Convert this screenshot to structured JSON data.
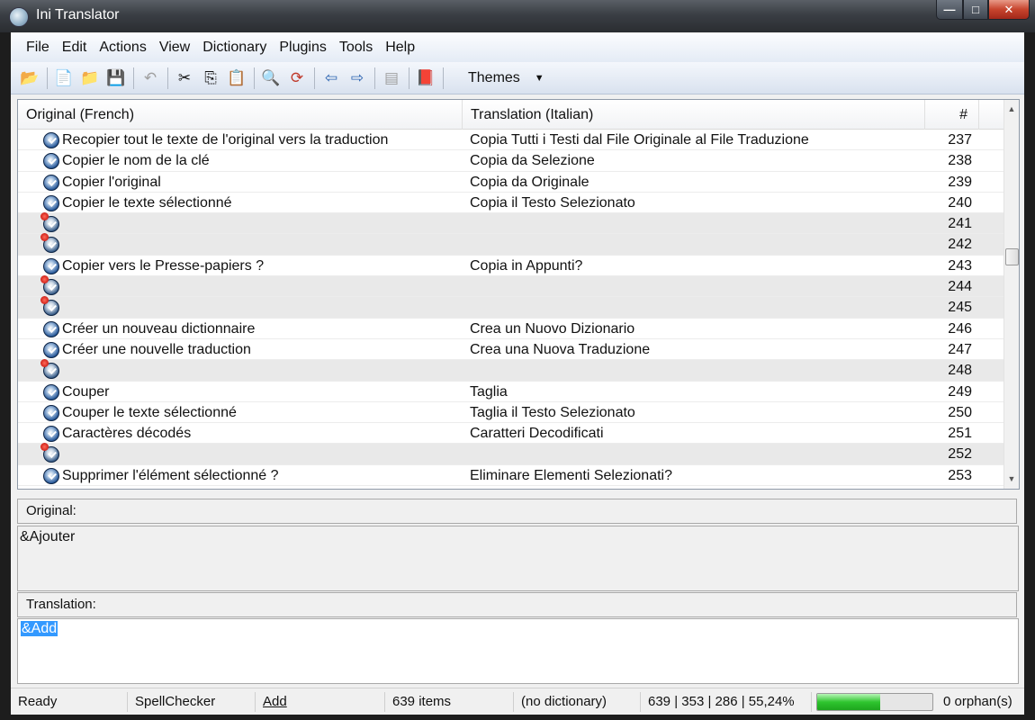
{
  "window": {
    "title": "Ini Translator",
    "min": "—",
    "max": "□",
    "close": "✕"
  },
  "menu": [
    "File",
    "Edit",
    "Actions",
    "View",
    "Dictionary",
    "Plugins",
    "Tools",
    "Help"
  ],
  "toolbar": {
    "icons": [
      "open-project-icon",
      "new-icon",
      "open-icon",
      "save-icon",
      "undo-icon",
      "cut-icon",
      "copy-icon",
      "paste-icon",
      "find-icon",
      "replace-icon",
      "back-icon",
      "forward-icon",
      "copy-original-icon",
      "dictionary-icon"
    ],
    "themes_label": "Themes",
    "themes_arrow": "▼"
  },
  "list": {
    "headers": {
      "original": "Original (French)",
      "translation": "Translation (Italian)",
      "number": "#"
    },
    "rows": [
      {
        "original": "Recopier tout le texte de l'original vers la traduction",
        "translation": "Copia Tutti i Testi dal File Originale al File Traduzione",
        "number": "237"
      },
      {
        "original": "Copier le nom de la clé",
        "translation": "Copia da Selezione",
        "number": "238"
      },
      {
        "original": "Copier l'original",
        "translation": "Copia da Originale",
        "number": "239"
      },
      {
        "original": "Copier le texte sélectionné",
        "translation": "Copia il Testo Selezionato",
        "number": "240"
      },
      {
        "original": "",
        "translation": "",
        "number": "241"
      },
      {
        "original": "",
        "translation": "",
        "number": "242"
      },
      {
        "original": "Copier vers le Presse-papiers ?",
        "translation": "Copia in Appunti?",
        "number": "243"
      },
      {
        "original": "",
        "translation": "",
        "number": "244"
      },
      {
        "original": "",
        "translation": "",
        "number": "245"
      },
      {
        "original": "Créer un nouveau dictionnaire",
        "translation": "Crea un Nuovo Dizionario",
        "number": "246"
      },
      {
        "original": "Créer une nouvelle traduction",
        "translation": "Crea una Nuova Traduzione",
        "number": "247"
      },
      {
        "original": "",
        "translation": "",
        "number": "248"
      },
      {
        "original": "Couper",
        "translation": "Taglia",
        "number": "249"
      },
      {
        "original": "Couper le texte sélectionné",
        "translation": "Taglia il Testo Selezionato",
        "number": "250"
      },
      {
        "original": "Caractères décodés",
        "translation": "Caratteri Decodificati",
        "number": "251"
      },
      {
        "original": "",
        "translation": "",
        "number": "252"
      },
      {
        "original": "Supprimer l'élément sélectionné ?",
        "translation": "Eliminare Elementi Selezionati?",
        "number": "253"
      }
    ]
  },
  "original_panel": {
    "label": "Original:",
    "value": "&Ajouter"
  },
  "translation_panel": {
    "label": "Translation:",
    "value": "&Add"
  },
  "status": {
    "ready": "Ready",
    "spellchecker": "SpellChecker",
    "language": "Add",
    "items": "639 items",
    "dictionary": "(no dictionary)",
    "counts": "639 | 353 | 286 | 55,24%",
    "progress": 0.55,
    "orphans": "0 orphan(s)"
  }
}
